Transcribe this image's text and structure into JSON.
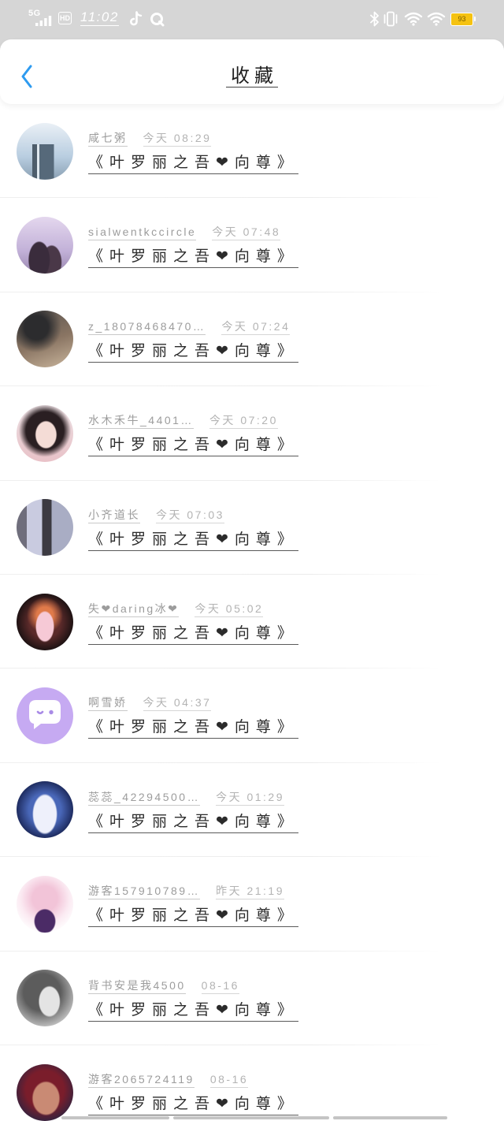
{
  "status_bar": {
    "network": "5G",
    "hd": "HD",
    "time": "11:02",
    "battery": "93",
    "battery_color": "#f5c211",
    "left_icons": [
      "signal-bars-icon",
      "hd-icon",
      "tiktok-icon",
      "q-circle-icon"
    ],
    "right_icons": [
      "bluetooth-icon",
      "vibrate-icon",
      "hotspot-wifi-icon",
      "wifi-icon",
      "battery-icon"
    ]
  },
  "header": {
    "title": "收藏",
    "back_icon": "chevron-left-icon",
    "accent_color": "#2e9bf0"
  },
  "favorites": [
    {
      "user": "咸七粥",
      "time": "今天 08:29",
      "title": "《叶罗丽之吾❤向尊》"
    },
    {
      "user": "sialwentkccircle",
      "time": "今天 07:48",
      "title": "《叶罗丽之吾❤向尊》"
    },
    {
      "user": "z_18078468470…",
      "time": "今天 07:24",
      "title": "《叶罗丽之吾❤向尊》"
    },
    {
      "user": "水木禾牛_4401…",
      "time": "今天 07:20",
      "title": "《叶罗丽之吾❤向尊》"
    },
    {
      "user": "小齐道长",
      "time": "今天 07:03",
      "title": "《叶罗丽之吾❤向尊》"
    },
    {
      "user": "失❤daring冰❤",
      "time": "今天 05:02",
      "title": "《叶罗丽之吾❤向尊》"
    },
    {
      "user": "啊雪娇",
      "time": "今天 04:37",
      "title": "《叶罗丽之吾❤向尊》",
      "avatar_icon": "chat-bubble-face-icon"
    },
    {
      "user": "蕊蕊_42294500…",
      "time": "今天 01:29",
      "title": "《叶罗丽之吾❤向尊》"
    },
    {
      "user": "游客157910789…",
      "time": "昨天 21:19",
      "title": "《叶罗丽之吾❤向尊》"
    },
    {
      "user": "背书安是我4500",
      "time": "08-16",
      "title": "《叶罗丽之吾❤向尊》"
    },
    {
      "user": "游客2065724119",
      "time": "08-16",
      "title": "《叶罗丽之吾❤向尊》"
    }
  ]
}
